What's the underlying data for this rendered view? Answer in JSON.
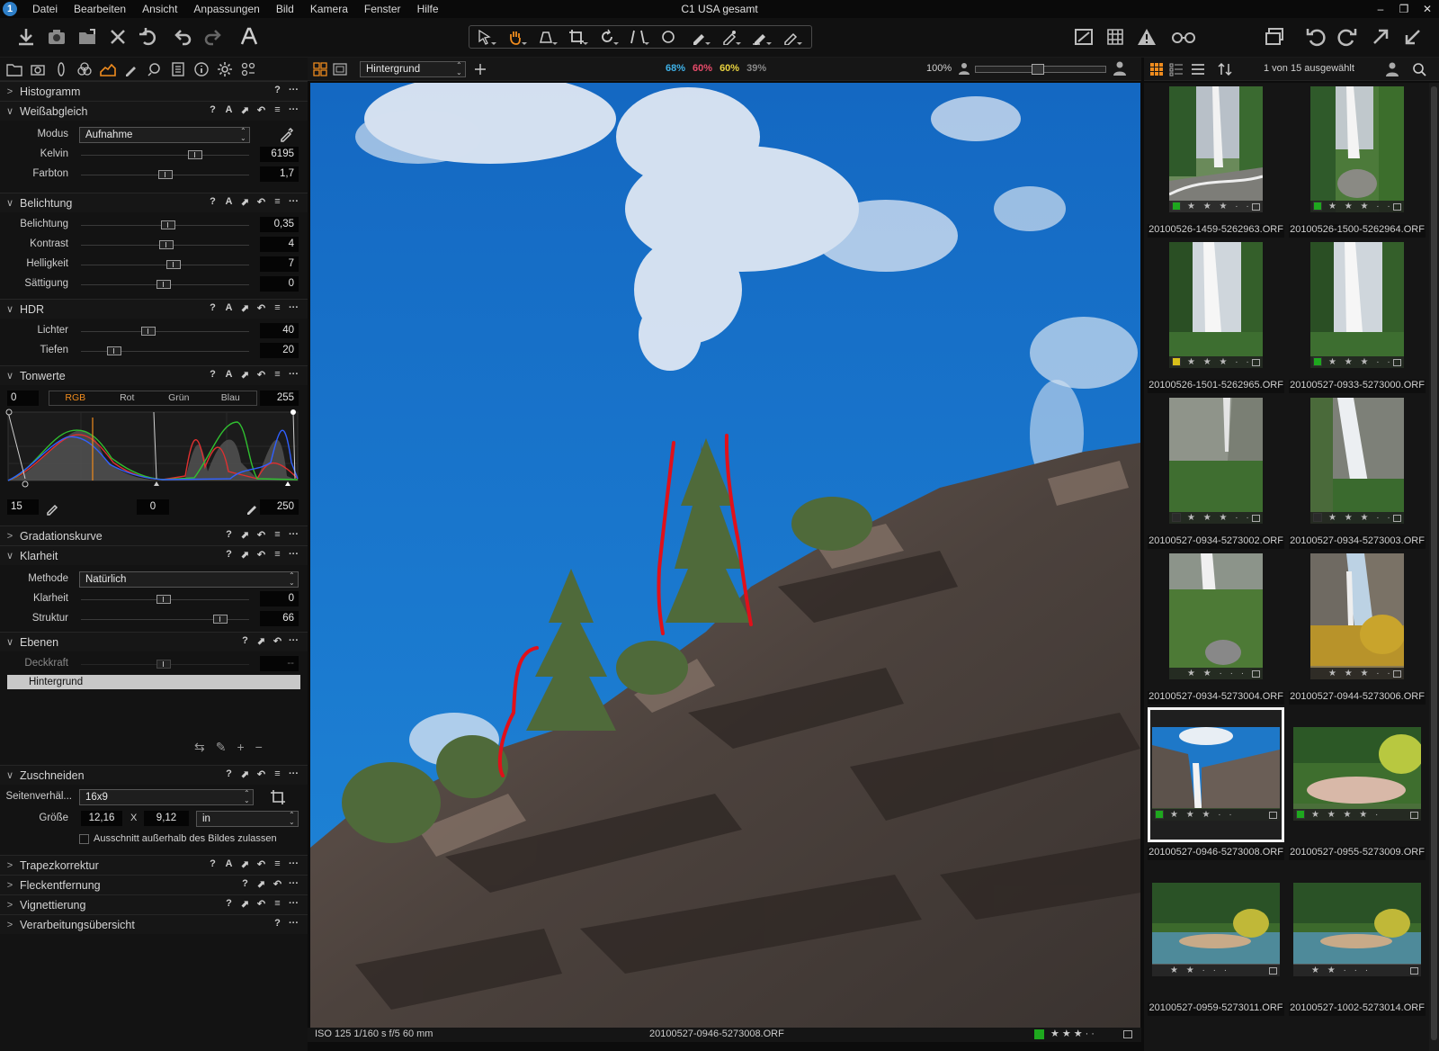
{
  "window": {
    "title": "C1 USA gesamt"
  },
  "menu": [
    "Datei",
    "Bearbeiten",
    "Ansicht",
    "Anpassungen",
    "Bild",
    "Kamera",
    "Fenster",
    "Hilfe"
  ],
  "colors": {
    "accent": "#f08c1e",
    "bg": "#131313",
    "cyan": "#3fb2e8",
    "magenta": "#e84b6a",
    "yellow": "#e8d23f"
  },
  "viewer": {
    "variant_select": "Hintergrund",
    "proof_values": [
      {
        "text": "68%",
        "color": "#3fb2e8"
      },
      {
        "text": "60%",
        "color": "#e84b6a"
      },
      {
        "text": "60%",
        "color": "#e8d23f"
      },
      {
        "text": "39%",
        "color": "#888888"
      }
    ],
    "zoom": "100%",
    "status_left": "ISO 125 1/160 s f/5 60 mm",
    "status_filename": "20100527-0946-5273008.ORF"
  },
  "browser": {
    "selection_count": "1 von 15 ausgewählt"
  },
  "sections": {
    "histogram": "Histogramm",
    "whitebalance": {
      "title": "Weißabgleich",
      "mode_label": "Modus",
      "mode_value": "Aufnahme",
      "kelvin_label": "Kelvin",
      "kelvin_value": "6195",
      "kelvin_pos": 0.68,
      "tint_label": "Farbton",
      "tint_value": "1,7",
      "tint_pos": 0.5
    },
    "exposure": {
      "title": "Belichtung",
      "rows": [
        {
          "label": "Belichtung",
          "value": "0,35",
          "pos": 0.52
        },
        {
          "label": "Kontrast",
          "value": "4",
          "pos": 0.51
        },
        {
          "label": "Helligkeit",
          "value": "7",
          "pos": 0.55
        },
        {
          "label": "Sättigung",
          "value": "0",
          "pos": 0.49
        }
      ]
    },
    "hdr": {
      "title": "HDR",
      "rows": [
        {
          "label": "Lichter",
          "value": "40",
          "pos": 0.4
        },
        {
          "label": "Tiefen",
          "value": "20",
          "pos": 0.2
        }
      ]
    },
    "levels": {
      "title": "Tonwerte",
      "in_black": "0",
      "in_white": "255",
      "channels": [
        "RGB",
        "Rot",
        "Grün",
        "Blau"
      ],
      "out_black": "15",
      "mid": "0",
      "out_white": "250"
    },
    "curve": "Gradationskurve",
    "clarity": {
      "title": "Klarheit",
      "method_label": "Methode",
      "method_value": "Natürlich",
      "rows": [
        {
          "label": "Klarheit",
          "value": "0",
          "pos": 0.49
        },
        {
          "label": "Struktur",
          "value": "66",
          "pos": 0.83
        }
      ]
    },
    "layers": {
      "title": "Ebenen",
      "opacity_label": "Deckkraft",
      "opacity_value": "--",
      "layer_name": "Hintergrund"
    },
    "crop": {
      "title": "Zuschneiden",
      "ratio_label": "Seitenverhäl...",
      "ratio_value": "16x9",
      "size_label": "Größe",
      "width": "12,16",
      "times": "X",
      "height": "9,12",
      "unit": "in",
      "outside_label": "Ausschnitt außerhalb des Bildes zulassen"
    },
    "keystone": "Trapezkorrektur",
    "spot": "Fleckentfernung",
    "vignette": "Vignettierung",
    "summary": "Verarbeitungsübersicht"
  },
  "thumbnails": [
    {
      "name": "20100526-1459-5262963.ORF",
      "tag": "#1ea81e",
      "stars": "★ ★ ★ · ·",
      "scene": "falls-road",
      "selected": false
    },
    {
      "name": "20100526-1500-5262964.ORF",
      "tag": "#1ea81e",
      "stars": "★ ★ ★ · ·",
      "scene": "falls-rock",
      "selected": false
    },
    {
      "name": "20100526-1501-5262965.ORF",
      "tag": "#d8c01a",
      "stars": "★ ★ ★ · ·",
      "scene": "falls-mist",
      "selected": false
    },
    {
      "name": "20100527-0933-5273000.ORF",
      "tag": "#1ea81e",
      "stars": "★ ★ ★ · ·",
      "scene": "falls-mist",
      "selected": false
    },
    {
      "name": "20100527-0934-5273002.ORF",
      "tag": "#2a2a2a",
      "stars": "★ ★ ★ · ·",
      "scene": "cliff-green",
      "selected": false
    },
    {
      "name": "20100527-0934-5273003.ORF",
      "tag": "#2a2a2a",
      "stars": "★ ★ ★ · ·",
      "scene": "falls-cliff",
      "selected": false
    },
    {
      "name": "20100527-0934-5273004.ORF",
      "tag": "",
      "stars": "★ ★ · · ·",
      "scene": "falls-trees",
      "selected": false
    },
    {
      "name": "20100527-0944-5273006.ORF",
      "tag": "",
      "stars": "★ ★ ★ · ·",
      "scene": "falls-autumn",
      "selected": false
    },
    {
      "name": "20100527-0946-5273008.ORF",
      "tag": "#1ea81e",
      "stars": "★ ★ ★ · ·",
      "scene": "wide-falls",
      "selected": true
    },
    {
      "name": "20100527-0955-5273009.ORF",
      "tag": "#1ea81e",
      "stars": "★ ★ ★ ★ ·",
      "scene": "wide-river",
      "selected": false
    },
    {
      "name": "20100527-0959-5273011.ORF",
      "tag": "",
      "stars": "★ ★ · · ·",
      "scene": "wide-river2",
      "selected": false
    },
    {
      "name": "20100527-1002-5273014.ORF",
      "tag": "",
      "stars": "★ ★ · · ·",
      "scene": "wide-river2",
      "selected": false
    }
  ]
}
